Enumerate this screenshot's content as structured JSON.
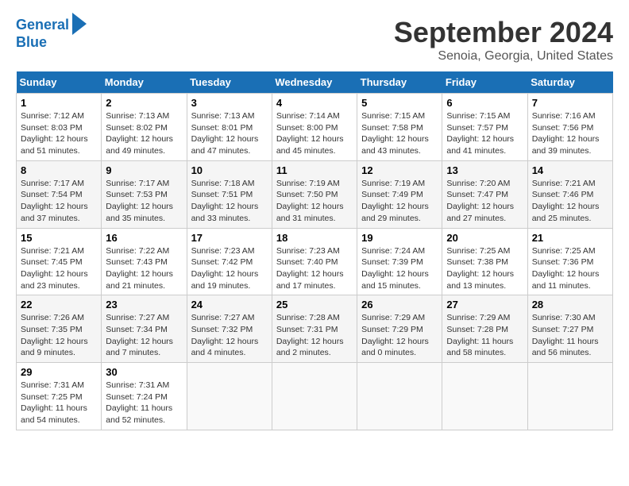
{
  "logo": {
    "line1": "General",
    "line2": "Blue"
  },
  "title": "September 2024",
  "subtitle": "Senoia, Georgia, United States",
  "days_of_week": [
    "Sunday",
    "Monday",
    "Tuesday",
    "Wednesday",
    "Thursday",
    "Friday",
    "Saturday"
  ],
  "weeks": [
    [
      {
        "day": "1",
        "sunrise": "7:12 AM",
        "sunset": "8:03 PM",
        "daylight": "12 hours and 51 minutes."
      },
      {
        "day": "2",
        "sunrise": "7:13 AM",
        "sunset": "8:02 PM",
        "daylight": "12 hours and 49 minutes."
      },
      {
        "day": "3",
        "sunrise": "7:13 AM",
        "sunset": "8:01 PM",
        "daylight": "12 hours and 47 minutes."
      },
      {
        "day": "4",
        "sunrise": "7:14 AM",
        "sunset": "8:00 PM",
        "daylight": "12 hours and 45 minutes."
      },
      {
        "day": "5",
        "sunrise": "7:15 AM",
        "sunset": "7:58 PM",
        "daylight": "12 hours and 43 minutes."
      },
      {
        "day": "6",
        "sunrise": "7:15 AM",
        "sunset": "7:57 PM",
        "daylight": "12 hours and 41 minutes."
      },
      {
        "day": "7",
        "sunrise": "7:16 AM",
        "sunset": "7:56 PM",
        "daylight": "12 hours and 39 minutes."
      }
    ],
    [
      {
        "day": "8",
        "sunrise": "7:17 AM",
        "sunset": "7:54 PM",
        "daylight": "12 hours and 37 minutes."
      },
      {
        "day": "9",
        "sunrise": "7:17 AM",
        "sunset": "7:53 PM",
        "daylight": "12 hours and 35 minutes."
      },
      {
        "day": "10",
        "sunrise": "7:18 AM",
        "sunset": "7:51 PM",
        "daylight": "12 hours and 33 minutes."
      },
      {
        "day": "11",
        "sunrise": "7:19 AM",
        "sunset": "7:50 PM",
        "daylight": "12 hours and 31 minutes."
      },
      {
        "day": "12",
        "sunrise": "7:19 AM",
        "sunset": "7:49 PM",
        "daylight": "12 hours and 29 minutes."
      },
      {
        "day": "13",
        "sunrise": "7:20 AM",
        "sunset": "7:47 PM",
        "daylight": "12 hours and 27 minutes."
      },
      {
        "day": "14",
        "sunrise": "7:21 AM",
        "sunset": "7:46 PM",
        "daylight": "12 hours and 25 minutes."
      }
    ],
    [
      {
        "day": "15",
        "sunrise": "7:21 AM",
        "sunset": "7:45 PM",
        "daylight": "12 hours and 23 minutes."
      },
      {
        "day": "16",
        "sunrise": "7:22 AM",
        "sunset": "7:43 PM",
        "daylight": "12 hours and 21 minutes."
      },
      {
        "day": "17",
        "sunrise": "7:23 AM",
        "sunset": "7:42 PM",
        "daylight": "12 hours and 19 minutes."
      },
      {
        "day": "18",
        "sunrise": "7:23 AM",
        "sunset": "7:40 PM",
        "daylight": "12 hours and 17 minutes."
      },
      {
        "day": "19",
        "sunrise": "7:24 AM",
        "sunset": "7:39 PM",
        "daylight": "12 hours and 15 minutes."
      },
      {
        "day": "20",
        "sunrise": "7:25 AM",
        "sunset": "7:38 PM",
        "daylight": "12 hours and 13 minutes."
      },
      {
        "day": "21",
        "sunrise": "7:25 AM",
        "sunset": "7:36 PM",
        "daylight": "12 hours and 11 minutes."
      }
    ],
    [
      {
        "day": "22",
        "sunrise": "7:26 AM",
        "sunset": "7:35 PM",
        "daylight": "12 hours and 9 minutes."
      },
      {
        "day": "23",
        "sunrise": "7:27 AM",
        "sunset": "7:34 PM",
        "daylight": "12 hours and 7 minutes."
      },
      {
        "day": "24",
        "sunrise": "7:27 AM",
        "sunset": "7:32 PM",
        "daylight": "12 hours and 4 minutes."
      },
      {
        "day": "25",
        "sunrise": "7:28 AM",
        "sunset": "7:31 PM",
        "daylight": "12 hours and 2 minutes."
      },
      {
        "day": "26",
        "sunrise": "7:29 AM",
        "sunset": "7:29 PM",
        "daylight": "12 hours and 0 minutes."
      },
      {
        "day": "27",
        "sunrise": "7:29 AM",
        "sunset": "7:28 PM",
        "daylight": "11 hours and 58 minutes."
      },
      {
        "day": "28",
        "sunrise": "7:30 AM",
        "sunset": "7:27 PM",
        "daylight": "11 hours and 56 minutes."
      }
    ],
    [
      {
        "day": "29",
        "sunrise": "7:31 AM",
        "sunset": "7:25 PM",
        "daylight": "11 hours and 54 minutes."
      },
      {
        "day": "30",
        "sunrise": "7:31 AM",
        "sunset": "7:24 PM",
        "daylight": "11 hours and 52 minutes."
      },
      null,
      null,
      null,
      null,
      null
    ]
  ]
}
